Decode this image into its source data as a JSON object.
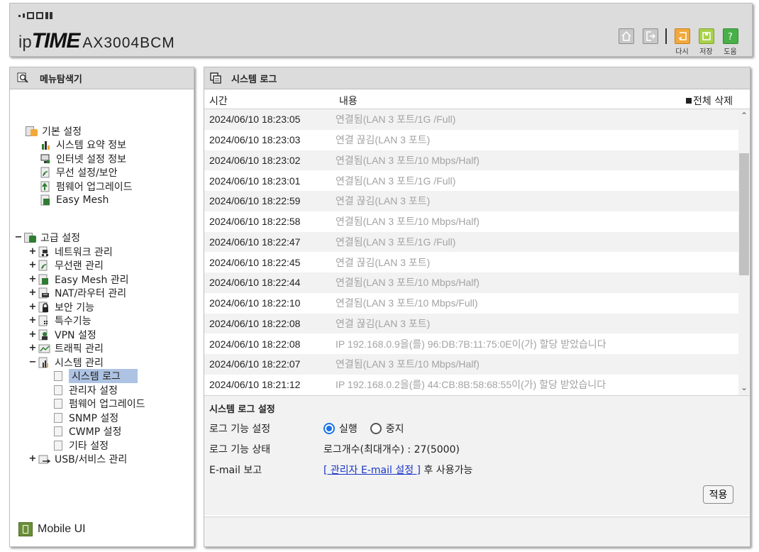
{
  "header": {
    "brand_ip": "ip",
    "brand_time": "TIME",
    "model": "AX3004BCM",
    "icons": [
      {
        "name": "home-icon",
        "caption": ""
      },
      {
        "name": "logout-icon",
        "caption": ""
      },
      {
        "name": "reload-icon",
        "caption": "다시"
      },
      {
        "name": "save-icon",
        "caption": "저장"
      },
      {
        "name": "help-icon",
        "caption": "도움"
      }
    ]
  },
  "sidebar": {
    "title": "메뉴탐색기",
    "basic": {
      "label": "기본 설정",
      "items": [
        "시스템 요약 정보",
        "인터넷 설정 정보",
        "무선 설정/보안",
        "펌웨어 업그레이드",
        "Easy Mesh"
      ]
    },
    "advanced": {
      "label": "고급 설정",
      "items": [
        "네트워크 관리",
        "무선랜 관리",
        "Easy Mesh 관리",
        "NAT/라우터 관리",
        "보안 기능",
        "특수기능",
        "VPN 설정",
        "트래픽 관리",
        "시스템 관리"
      ],
      "system_children": [
        "시스템 로그",
        "관리자 설정",
        "펌웨어 업그레이드",
        "SNMP 설정",
        "CWMP 설정",
        "기타 설정"
      ],
      "last": "USB/서비스 관리"
    },
    "mobile_ui": "Mobile UI",
    "expand_plus": "+",
    "collapse_minus": "−"
  },
  "main": {
    "title": "시스템 로그",
    "col_time": "시간",
    "col_content": "내용",
    "delete_all": "전체 삭제",
    "logs": [
      {
        "time": "2024/06/10 18:23:05",
        "msg": "연결됨(LAN 3 포트/1G /Full)"
      },
      {
        "time": "2024/06/10 18:23:03",
        "msg": "연결 끊김(LAN 3 포트)"
      },
      {
        "time": "2024/06/10 18:23:02",
        "msg": "연결됨(LAN 3 포트/10 Mbps/Half)"
      },
      {
        "time": "2024/06/10 18:23:01",
        "msg": "연결됨(LAN 3 포트/1G /Full)"
      },
      {
        "time": "2024/06/10 18:22:59",
        "msg": "연결 끊김(LAN 3 포트)"
      },
      {
        "time": "2024/06/10 18:22:58",
        "msg": "연결됨(LAN 3 포트/10 Mbps/Half)"
      },
      {
        "time": "2024/06/10 18:22:47",
        "msg": "연결됨(LAN 3 포트/1G /Full)"
      },
      {
        "time": "2024/06/10 18:22:45",
        "msg": "연결 끊김(LAN 3 포트)"
      },
      {
        "time": "2024/06/10 18:22:44",
        "msg": "연결됨(LAN 3 포트/10 Mbps/Half)"
      },
      {
        "time": "2024/06/10 18:22:10",
        "msg": "연결됨(LAN 3 포트/10 Mbps/Full)"
      },
      {
        "time": "2024/06/10 18:22:08",
        "msg": "연결 끊김(LAN 3 포트)"
      },
      {
        "time": "2024/06/10 18:22:08",
        "msg": "IP 192.168.0.9을(를) 96:DB:7B:11:75:0E이(가) 할당 받았습니다"
      },
      {
        "time": "2024/06/10 18:22:07",
        "msg": "연결됨(LAN 3 포트/10 Mbps/Half)"
      },
      {
        "time": "2024/06/10 18:21:12",
        "msg": "IP 192.168.0.2을(를) 44:CB:8B:58:68:55이(가) 할당 받았습니다"
      }
    ],
    "settings": {
      "title": "시스템 로그 설정",
      "log_func_label": "로그 기능 설정",
      "opt_run": "실행",
      "opt_stop": "중지",
      "selected": "실행",
      "log_state_label": "로그 기능 상태",
      "log_state_value": "로그개수(최대개수) : 27(5000)",
      "email_label": "E-mail 보고",
      "email_link": "[ 관리자 E-mail 설정 ]",
      "email_suffix": " 후 사용가능",
      "apply": "적용"
    }
  },
  "colors": {
    "panel_gray": "#dcdcdc",
    "selected_bg": "#aec3e3",
    "radio_blue": "#1a73e8",
    "link_blue": "#1a37c8",
    "log_text_gray": "#a3a3a3"
  }
}
